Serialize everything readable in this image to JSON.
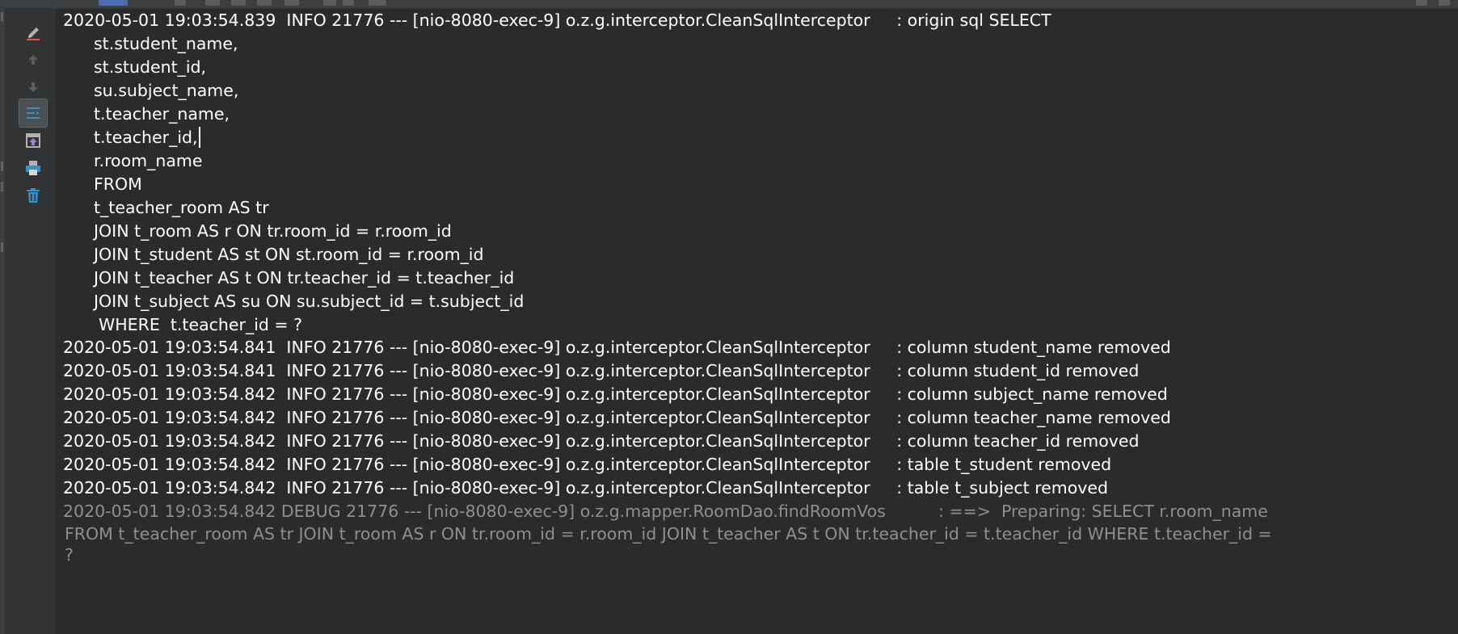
{
  "toolbar_icons": [
    "soft-wrap-icon",
    "up-arrow-icon",
    "down-arrow-icon",
    "filter-icon",
    "scroll-to-end-icon",
    "print-icon",
    "trash-icon"
  ],
  "log": {
    "header": "2020-05-01 19:03:54.839  INFO 21776 --- [nio-8080-exec-9] o.z.g.interceptor.CleanSqlInterceptor     : origin sql SELECT",
    "sql_lines": [
      "st.student_name,",
      "st.student_id,",
      "su.subject_name,",
      "t.teacher_name,",
      "t.teacher_id,",
      "r.room_name",
      "FROM",
      "t_teacher_room AS tr",
      "JOIN t_room AS r ON tr.room_id = r.room_id",
      "JOIN t_student AS st ON st.room_id = r.room_id",
      "JOIN t_teacher AS t ON tr.teacher_id = t.teacher_id",
      "JOIN t_subject AS su ON su.subject_id = t.subject_id"
    ],
    "where_line": "WHERE  t.teacher_id = ?",
    "info_lines": [
      "2020-05-01 19:03:54.841  INFO 21776 --- [nio-8080-exec-9] o.z.g.interceptor.CleanSqlInterceptor     : column student_name removed",
      "2020-05-01 19:03:54.841  INFO 21776 --- [nio-8080-exec-9] o.z.g.interceptor.CleanSqlInterceptor     : column student_id removed",
      "2020-05-01 19:03:54.842  INFO 21776 --- [nio-8080-exec-9] o.z.g.interceptor.CleanSqlInterceptor     : column subject_name removed",
      "2020-05-01 19:03:54.842  INFO 21776 --- [nio-8080-exec-9] o.z.g.interceptor.CleanSqlInterceptor     : column teacher_name removed",
      "2020-05-01 19:03:54.842  INFO 21776 --- [nio-8080-exec-9] o.z.g.interceptor.CleanSqlInterceptor     : column teacher_id removed",
      "2020-05-01 19:03:54.842  INFO 21776 --- [nio-8080-exec-9] o.z.g.interceptor.CleanSqlInterceptor     : table t_student removed",
      "2020-05-01 19:03:54.842  INFO 21776 --- [nio-8080-exec-9] o.z.g.interceptor.CleanSqlInterceptor     : table t_subject removed"
    ],
    "debug_line": "2020-05-01 19:03:54.842 DEBUG 21776 --- [nio-8080-exec-9] o.z.g.mapper.RoomDao.findRoomVos          : ==>  Preparing: SELECT r.room_name",
    "debug_cont": "FROM t_teacher_room AS tr JOIN t_room AS r ON tr.room_id = r.room_id JOIN t_teacher AS t ON tr.teacher_id = t.teacher_id WHERE t.teacher_id =",
    "debug_cont2": "?"
  },
  "colors": {
    "background": "#2b2b2b",
    "info_text": "#ffffff",
    "debug_text": "#8f8f8f"
  }
}
